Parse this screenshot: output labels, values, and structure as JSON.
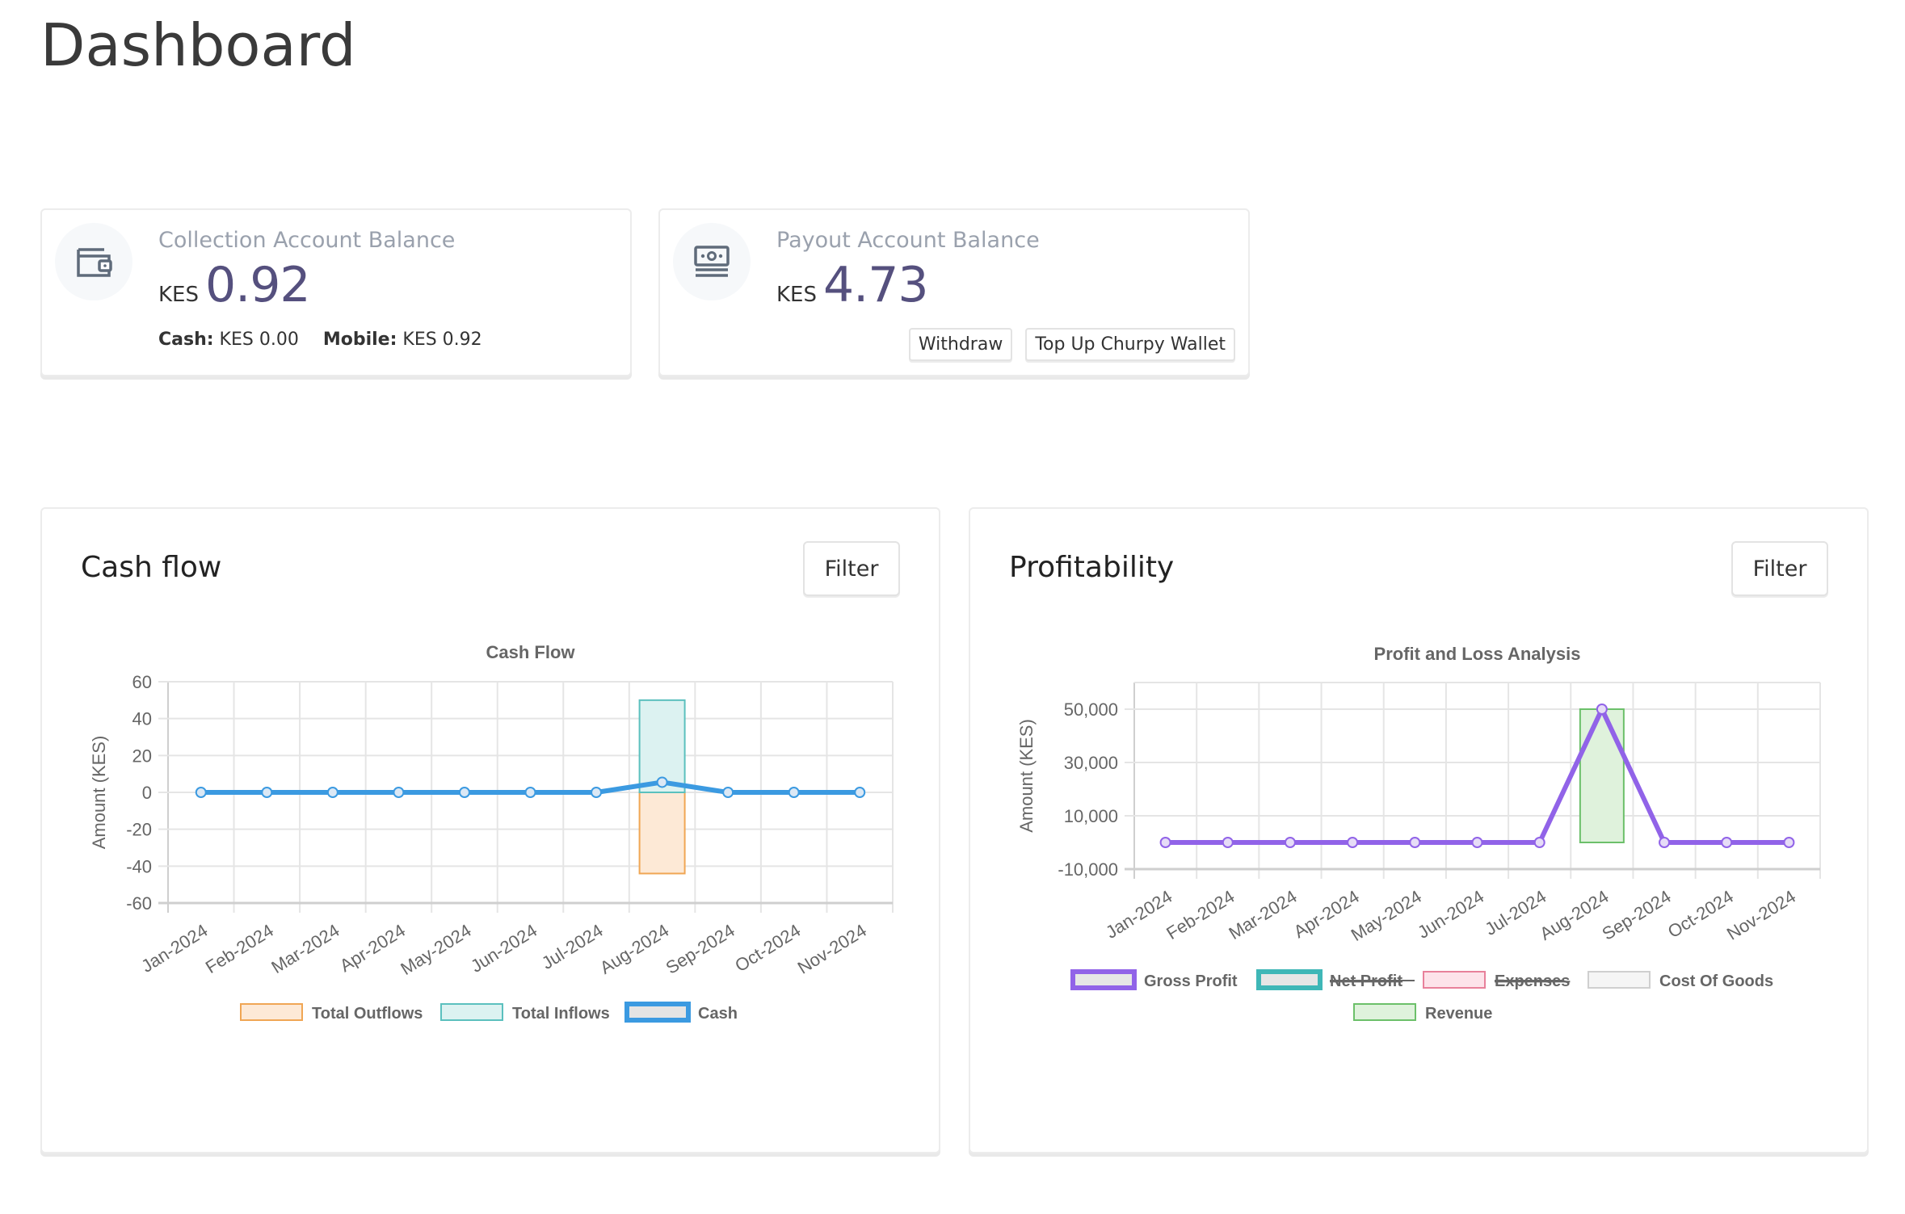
{
  "page": {
    "title": "Dashboard"
  },
  "collection": {
    "label": "Collection Account Balance",
    "currency": "KES",
    "amount": "0.92",
    "cash_label": "Cash:",
    "cash_value": "KES 0.00",
    "mobile_label": "Mobile:",
    "mobile_value": "KES 0.92",
    "icon": "wallet-icon"
  },
  "payout": {
    "label": "Payout Account Balance",
    "currency": "KES",
    "amount": "4.73",
    "withdraw_label": "Withdraw",
    "topup_label": "Top Up Churpy Wallet",
    "icon": "money-bill-icon"
  },
  "cashflow_card": {
    "title": "Cash flow",
    "filter_label": "Filter"
  },
  "profit_card": {
    "title": "Profitability",
    "filter_label": "Filter"
  },
  "colors": {
    "cash": "#3b9ae1",
    "inflow_border": "#5bc0be",
    "inflow_fill": "#dcf2f1",
    "outflow_border": "#f0a654",
    "outflow_fill": "#fde9d6",
    "gross_profit": "#9163e8",
    "net_profit": "#3fb7b7",
    "expenses": "#e8819b",
    "expenses_fill": "#fde3ea",
    "cost_of_goods": "#cfcfcf",
    "revenue_border": "#6cc06a",
    "revenue_fill": "#dff2dc",
    "amount_text": "#55507e"
  },
  "chart_data": [
    {
      "type": "bar",
      "title": "Cash Flow",
      "xlabel": "",
      "ylabel": "Amount (KES)",
      "ylim": [
        -60,
        60
      ],
      "yticks": [
        60,
        40,
        20,
        0,
        -20,
        -40,
        -60
      ],
      "grid": true,
      "legend_position": "bottom",
      "categories": [
        "Jan-2024",
        "Feb-2024",
        "Mar-2024",
        "Apr-2024",
        "May-2024",
        "Jun-2024",
        "Jul-2024",
        "Aug-2024",
        "Sep-2024",
        "Oct-2024",
        "Nov-2024"
      ],
      "series": [
        {
          "name": "Total Outflows",
          "kind": "bar",
          "values": [
            0,
            0,
            0,
            0,
            0,
            0,
            0,
            -44,
            0,
            0,
            0
          ]
        },
        {
          "name": "Total Inflows",
          "kind": "bar",
          "values": [
            0,
            0,
            0,
            0,
            0,
            0,
            0,
            50,
            0,
            0,
            0
          ]
        },
        {
          "name": "Cash",
          "kind": "line",
          "values": [
            0,
            0,
            0,
            0,
            0,
            0,
            0,
            5.5,
            0,
            0,
            0
          ]
        }
      ]
    },
    {
      "type": "bar",
      "title": "Profit and Loss Analysis",
      "xlabel": "",
      "ylabel": "Amount (KES)",
      "ylim": [
        -10000,
        60000
      ],
      "yticks": [
        50000,
        30000,
        10000,
        -10000
      ],
      "ytick_labels": [
        "50,000",
        "30,000",
        "10,000",
        "-10,000"
      ],
      "grid": true,
      "legend_position": "bottom",
      "categories": [
        "Jan-2024",
        "Feb-2024",
        "Mar-2024",
        "Apr-2024",
        "May-2024",
        "Jun-2024",
        "Jul-2024",
        "Aug-2024",
        "Sep-2024",
        "Oct-2024",
        "Nov-2024"
      ],
      "series": [
        {
          "name": "Gross Profit",
          "kind": "line",
          "hidden": false,
          "values": [
            0,
            0,
            0,
            0,
            0,
            0,
            0,
            50000,
            0,
            0,
            0
          ]
        },
        {
          "name": "Net Profit",
          "kind": "line",
          "hidden": true,
          "values": []
        },
        {
          "name": "Expenses",
          "kind": "bar",
          "hidden": true,
          "values": []
        },
        {
          "name": "Cost Of Goods",
          "kind": "bar",
          "hidden": false,
          "values": [
            0,
            0,
            0,
            0,
            0,
            0,
            0,
            0,
            0,
            0,
            0
          ]
        },
        {
          "name": "Revenue",
          "kind": "bar",
          "hidden": false,
          "values": [
            0,
            0,
            0,
            0,
            0,
            0,
            0,
            50000,
            0,
            0,
            0
          ]
        }
      ]
    }
  ]
}
